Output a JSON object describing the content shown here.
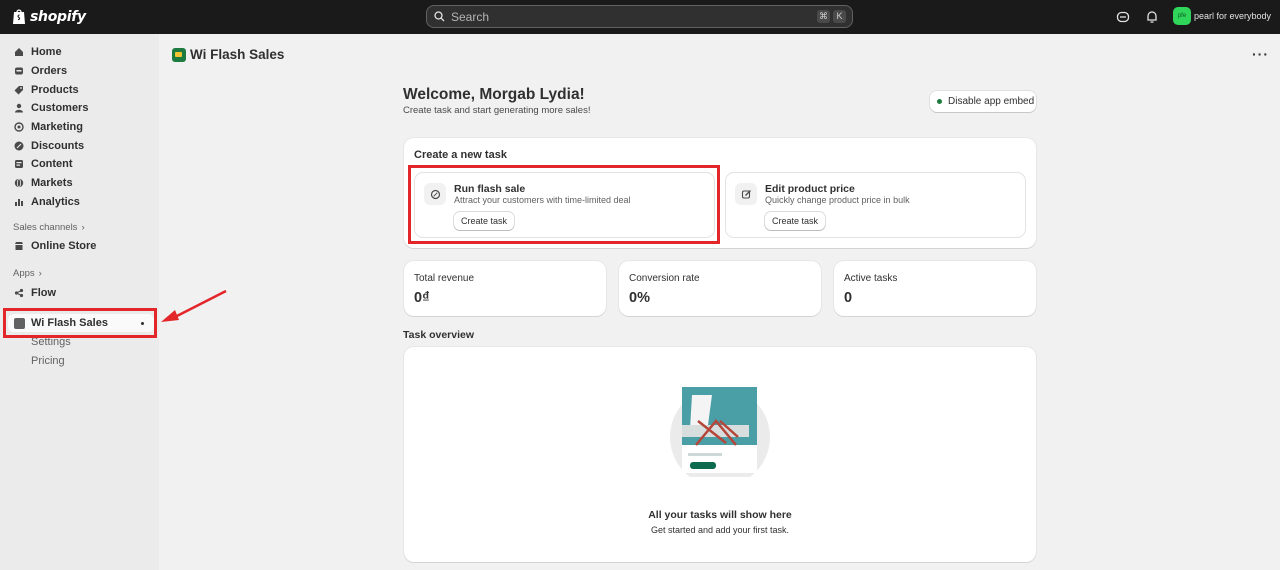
{
  "topbar": {
    "logo_text": "shopify",
    "search_placeholder": "Search",
    "shortcut_keys": [
      "⌘",
      "K"
    ],
    "avatar_initials": "pfe",
    "store_name": "pearl for everybody",
    "icons": [
      "shopify-bag-icon",
      "search-icon",
      "sidekick-icon",
      "bell-icon"
    ]
  },
  "sidebar": {
    "items": [
      {
        "label": "Home",
        "icon": "home-icon"
      },
      {
        "label": "Orders",
        "icon": "orders-icon"
      },
      {
        "label": "Products",
        "icon": "tag-icon"
      },
      {
        "label": "Customers",
        "icon": "person-icon"
      },
      {
        "label": "Marketing",
        "icon": "target-icon"
      },
      {
        "label": "Discounts",
        "icon": "discount-icon"
      },
      {
        "label": "Content",
        "icon": "content-icon"
      },
      {
        "label": "Markets",
        "icon": "globe-icon"
      },
      {
        "label": "Analytics",
        "icon": "chart-icon"
      }
    ],
    "sales_channels_label": "Sales channels",
    "online_store_label": "Online Store",
    "apps_label": "Apps",
    "flow_label": "Flow",
    "active_app_label": "Wi Flash Sales",
    "sub_items": [
      "Settings",
      "Pricing"
    ]
  },
  "app": {
    "title": "Wi Flash Sales",
    "more_label": "···"
  },
  "main": {
    "welcome_title": "Welcome, Morgab Lydia!",
    "welcome_subtitle": "Create task and start generating more sales!",
    "disable_button": "Disable app embed",
    "create_task_section": {
      "title": "Create a new task",
      "tasks": [
        {
          "title": "Run flash sale",
          "description": "Attract your customers with time-limited deal",
          "button": "Create task",
          "icon": "flash-sale-icon"
        },
        {
          "title": "Edit product price",
          "description": "Quickly change product price in bulk",
          "button": "Create task",
          "icon": "edit-icon"
        }
      ]
    },
    "stats": [
      {
        "label": "Total revenue",
        "value": "0₫"
      },
      {
        "label": "Conversion rate",
        "value": "0%"
      },
      {
        "label": "Active tasks",
        "value": "0"
      }
    ],
    "task_overview": {
      "title": "Task overview",
      "empty_title": "All your tasks will show here",
      "empty_subtitle": "Get started and add your first task."
    }
  },
  "colors": {
    "topbar_bg": "#1a1a1a",
    "sidebar_bg": "#ebebeb",
    "page_bg": "#f1f1f1",
    "highlight_red": "#e3262a",
    "accent_green": "#1e7b3f"
  }
}
